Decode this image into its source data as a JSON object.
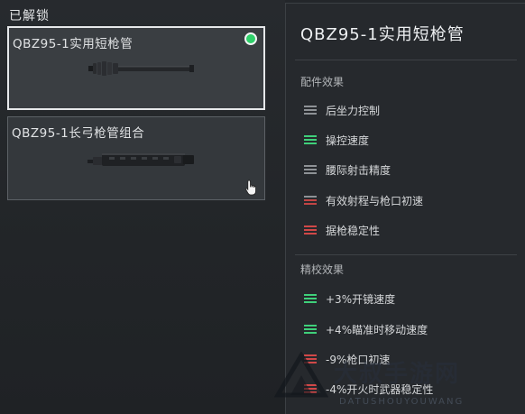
{
  "left": {
    "section_title": "已解锁",
    "cards": [
      {
        "name": "QBZ95-1实用短枪管",
        "equipped": true
      },
      {
        "name": "QBZ95-1长弓枪管组合",
        "equipped": false
      }
    ]
  },
  "panel": {
    "title": "QBZ95-1实用短枪管",
    "attachment_label": "配件效果",
    "attachment_effects": [
      {
        "label": "后坐力控制",
        "icon": "stat-bars-icon",
        "color": "#8e9296"
      },
      {
        "label": "操控速度",
        "icon": "stat-bars-icon",
        "color": "#3fd07a"
      },
      {
        "label": "腰际射击精度",
        "icon": "stat-bars-icon",
        "color": "#8e9296"
      },
      {
        "label": "有效射程与枪口初速",
        "icon": "stat-bars-icon",
        "color": "#c24545"
      },
      {
        "label": "据枪稳定性",
        "icon": "stat-bars-icon",
        "color": "#d04848"
      }
    ],
    "tuning_label": "精校效果",
    "tuning_effects": [
      {
        "label": "+3%开镜速度",
        "icon": "stat-bars-icon",
        "color": "#3fd07a"
      },
      {
        "label": "+4%瞄准时移动速度",
        "icon": "stat-bars-icon",
        "color": "#3fd07a"
      },
      {
        "label": "-9%枪口初速",
        "icon": "stat-bars-icon",
        "color": "#d04848"
      },
      {
        "label": "-4%开火时武器稳定性",
        "icon": "stat-bars-icon",
        "color": "#d04848"
      }
    ]
  },
  "watermark": {
    "main": "大叔手游网",
    "sub": "DATUSHOUYOUWANG"
  },
  "colors": {
    "positive": "#3fd07a",
    "negative": "#d04848",
    "neutral": "#8e9296",
    "equipped_dot": "#2fd06a"
  }
}
